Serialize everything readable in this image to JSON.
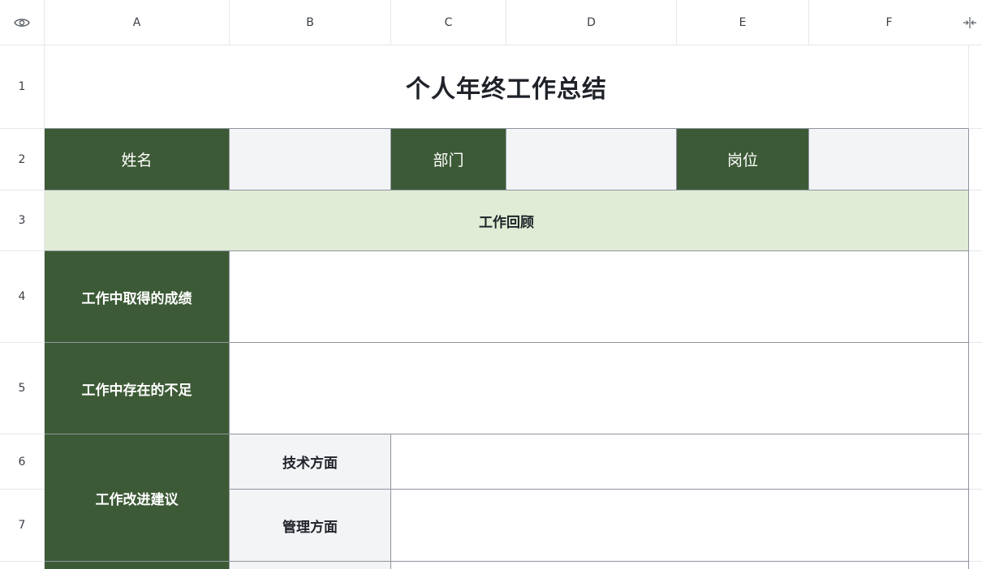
{
  "columns": [
    "A",
    "B",
    "C",
    "D",
    "E",
    "F"
  ],
  "rows": [
    "1",
    "2",
    "3",
    "4",
    "5",
    "6",
    "7"
  ],
  "title": "个人年终工作总结",
  "info_row": {
    "name_label": "姓名",
    "dept_label": "部门",
    "position_label": "岗位"
  },
  "section_header": "工作回顾",
  "achievements_label": "工作中取得的成绩",
  "shortcomings_label": "工作中存在的不足",
  "improvement_label": "工作改进建议",
  "tech_label": "技术方面",
  "mgmt_label": "管理方面",
  "icons": {
    "corner": "eye-icon",
    "collapse": "collapse-columns-icon"
  },
  "colors": {
    "dark_green": "#3d5a36",
    "light_green": "#e0ecd5",
    "light_gray": "#f3f4f6"
  }
}
